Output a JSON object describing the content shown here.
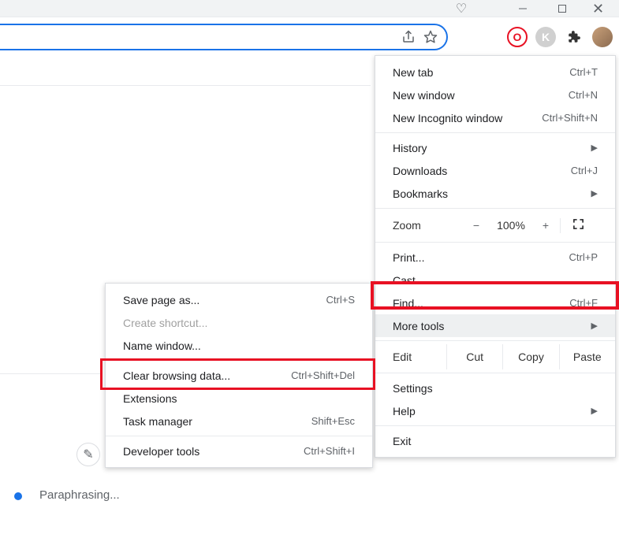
{
  "toolbar": {
    "share_icon": "share-icon",
    "star_icon": "star-icon"
  },
  "ext": {
    "opera": "O",
    "k": "K"
  },
  "menu": {
    "new_tab": {
      "label": "New tab",
      "shortcut": "Ctrl+T"
    },
    "new_window": {
      "label": "New window",
      "shortcut": "Ctrl+N"
    },
    "incognito": {
      "label": "New Incognito window",
      "shortcut": "Ctrl+Shift+N"
    },
    "history": {
      "label": "History"
    },
    "downloads": {
      "label": "Downloads",
      "shortcut": "Ctrl+J"
    },
    "bookmarks": {
      "label": "Bookmarks"
    },
    "zoom": {
      "label": "Zoom",
      "value": "100%",
      "minus": "−",
      "plus": "+"
    },
    "print": {
      "label": "Print...",
      "shortcut": "Ctrl+P"
    },
    "cast": {
      "label": "Cast..."
    },
    "find": {
      "label": "Find...",
      "shortcut": "Ctrl+F"
    },
    "more_tools": {
      "label": "More tools"
    },
    "edit": {
      "label": "Edit",
      "cut": "Cut",
      "copy": "Copy",
      "paste": "Paste"
    },
    "settings": {
      "label": "Settings"
    },
    "help": {
      "label": "Help"
    },
    "exit": {
      "label": "Exit"
    }
  },
  "submenu": {
    "save_page": {
      "label": "Save page as...",
      "shortcut": "Ctrl+S"
    },
    "create_shortcut": {
      "label": "Create shortcut..."
    },
    "name_window": {
      "label": "Name window..."
    },
    "clear_data": {
      "label": "Clear browsing data...",
      "shortcut": "Ctrl+Shift+Del"
    },
    "extensions": {
      "label": "Extensions"
    },
    "task_manager": {
      "label": "Task manager",
      "shortcut": "Shift+Esc"
    },
    "dev_tools": {
      "label": "Developer tools",
      "shortcut": "Ctrl+Shift+I"
    }
  },
  "status": {
    "text": "Paraphrasing..."
  }
}
